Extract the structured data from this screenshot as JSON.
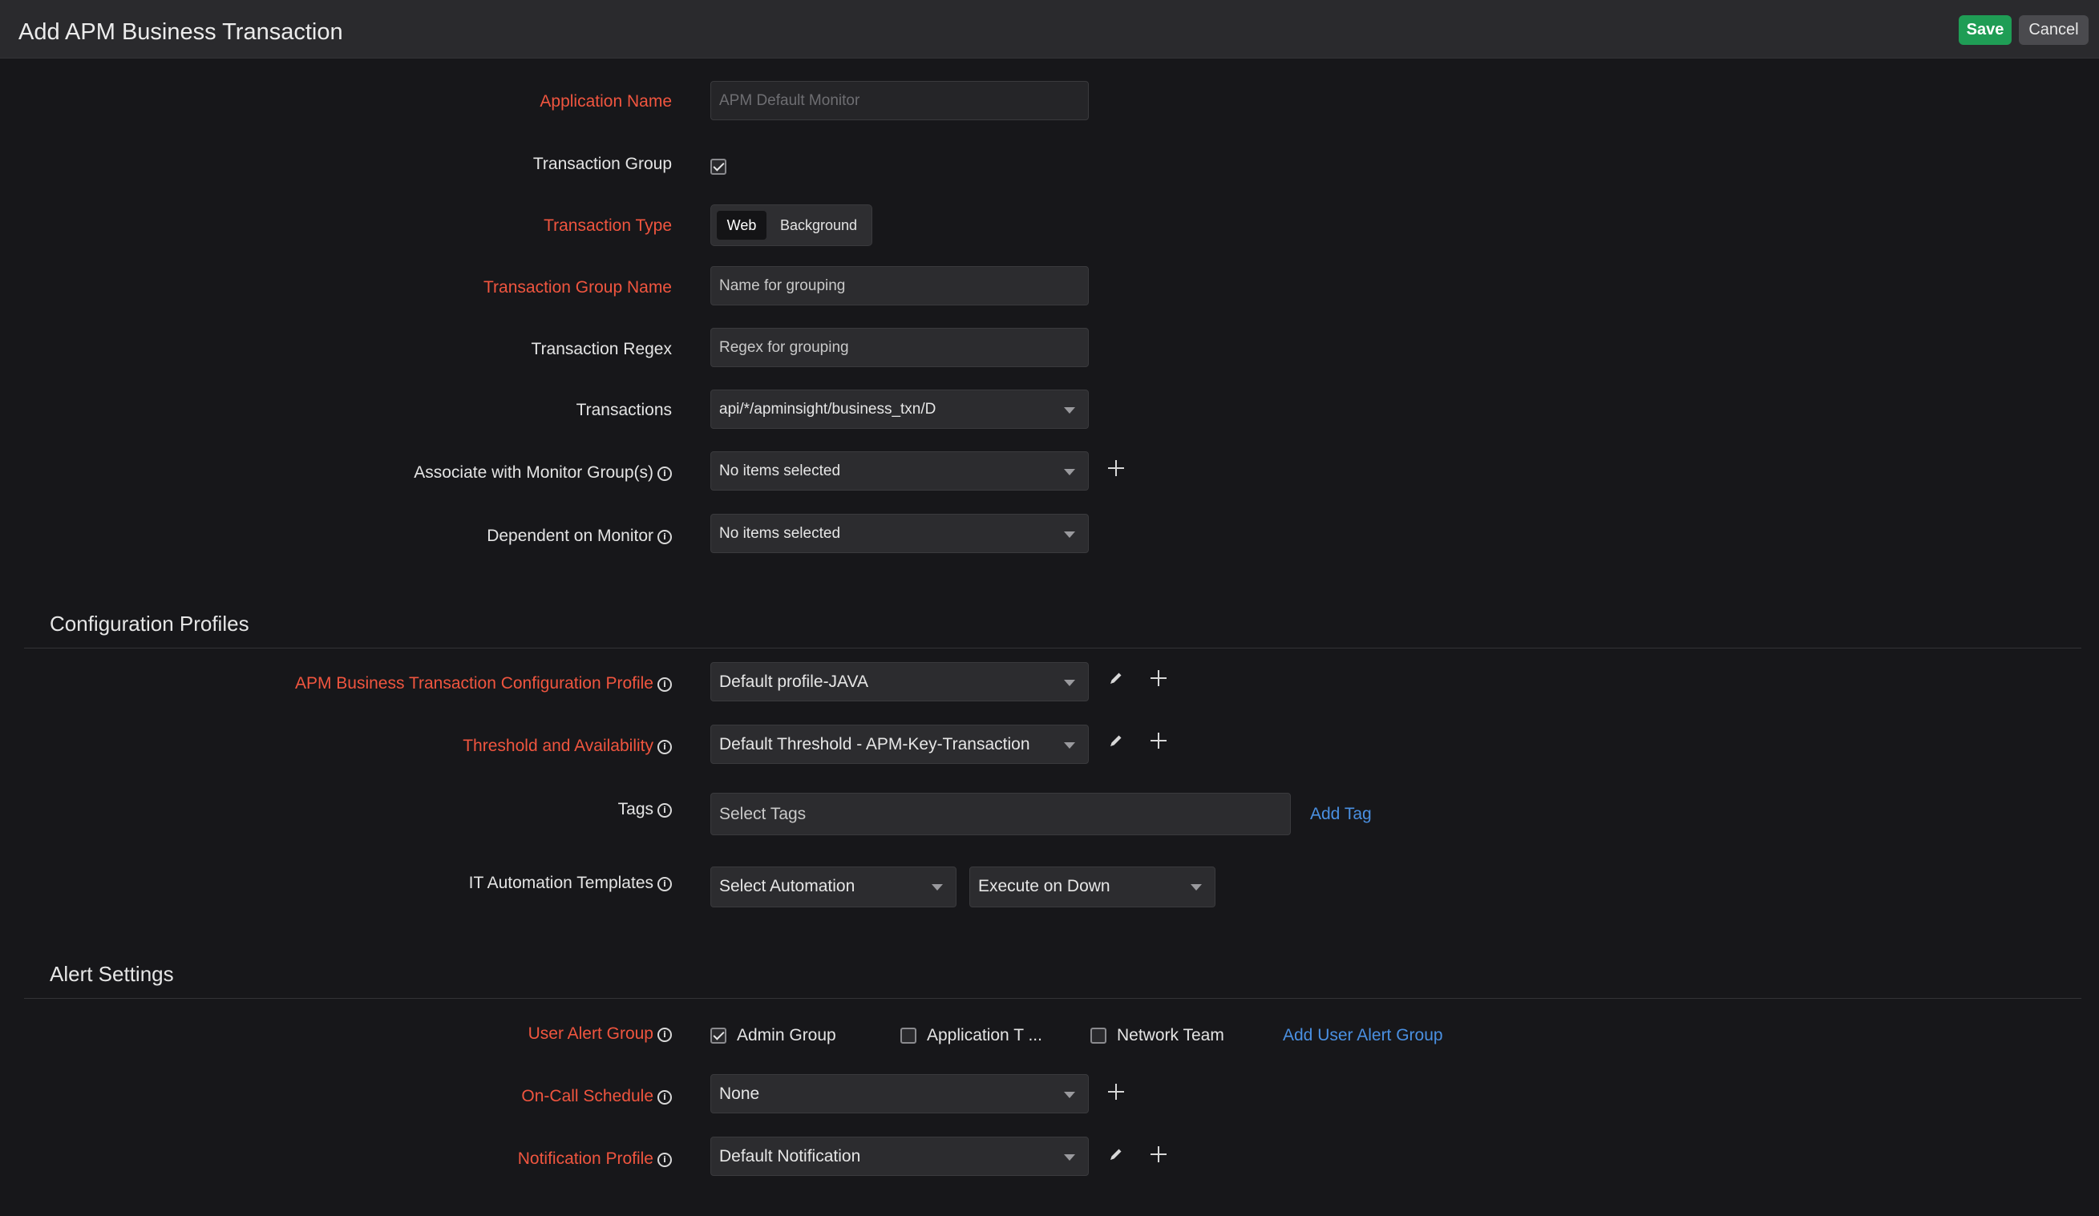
{
  "header": {
    "title": "Add APM Business Transaction",
    "save_label": "Save",
    "cancel_label": "Cancel"
  },
  "fields": {
    "application_name": {
      "label": "Application Name",
      "placeholder": "APM Default Monitor"
    },
    "transaction_group": {
      "label": "Transaction Group",
      "checked": true
    },
    "transaction_type": {
      "label": "Transaction Type",
      "options": [
        "Web",
        "Background"
      ],
      "selected": "Web"
    },
    "transaction_group_name": {
      "label": "Transaction Group Name",
      "placeholder": "Name for grouping"
    },
    "transaction_regex": {
      "label": "Transaction Regex",
      "placeholder": "Regex for grouping"
    },
    "transactions": {
      "label": "Transactions",
      "value": "api/*/apminsight/business_txn/D"
    },
    "monitor_groups": {
      "label": "Associate with Monitor Group(s)",
      "value": "No items selected"
    },
    "dependent_monitor": {
      "label": "Dependent on Monitor",
      "value": "No items selected"
    }
  },
  "config_profiles": {
    "title": "Configuration Profiles",
    "apm_profile": {
      "label": "APM Business Transaction Configuration Profile",
      "value": "Default profile-JAVA"
    },
    "threshold": {
      "label": "Threshold and Availability",
      "value": "Default Threshold - APM-Key-Transaction"
    },
    "tags": {
      "label": "Tags",
      "placeholder": "Select Tags",
      "add_link": "Add Tag"
    },
    "it_automation": {
      "label": "IT Automation Templates",
      "automation_value": "Select Automation",
      "execute_value": "Execute on Down"
    }
  },
  "alert_settings": {
    "title": "Alert Settings",
    "user_alert_group": {
      "label": "User Alert Group",
      "options": [
        {
          "label": "Admin Group",
          "checked": true
        },
        {
          "label": "Application T ...",
          "checked": false
        },
        {
          "label": "Network Team",
          "checked": false
        }
      ],
      "add_link": "Add User Alert Group"
    },
    "on_call": {
      "label": "On-Call Schedule",
      "value": "None"
    },
    "notification": {
      "label": "Notification Profile",
      "value": "Default Notification"
    }
  },
  "icons": {
    "info": "info-icon",
    "plus": "plus-icon",
    "edit": "pencil-icon",
    "dropdown": "caret-down-icon",
    "check": "checkmark-icon"
  },
  "colors": {
    "required_label": "#f0553f",
    "save_button": "#1f9d55",
    "link": "#4a90e2",
    "background": "#17171a"
  }
}
